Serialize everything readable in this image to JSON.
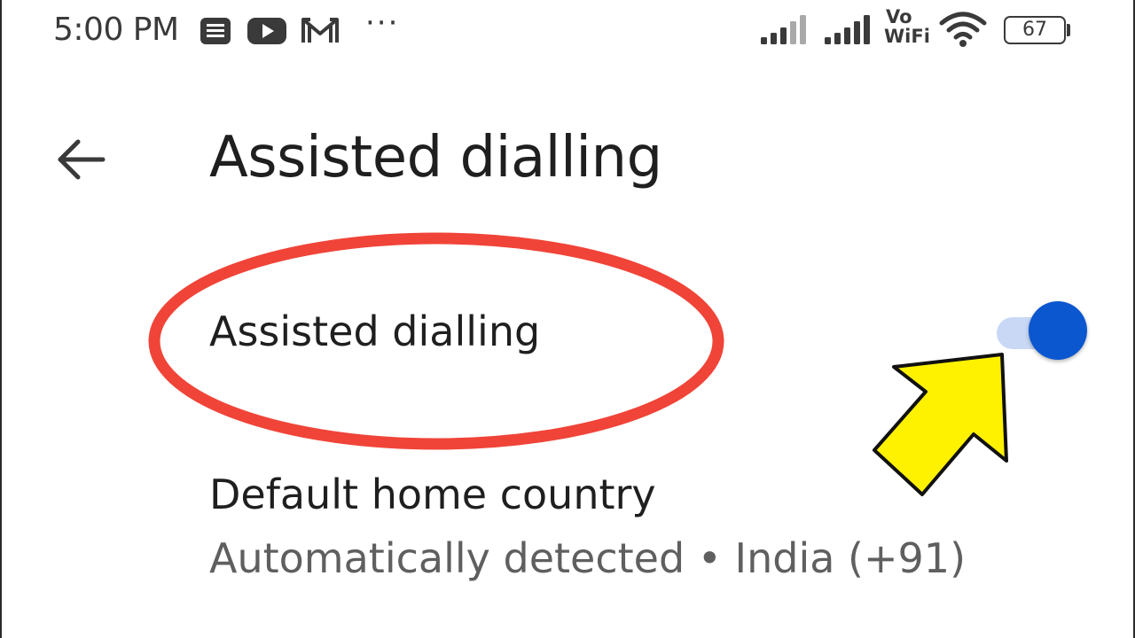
{
  "status_bar": {
    "time": "5:00 PM",
    "notification_icons": [
      "news-icon",
      "youtube-icon",
      "gmail-icon"
    ],
    "more_notifications": "···",
    "signal_icons": [
      "signal-sim1-icon",
      "signal-sim2-icon"
    ],
    "vowifi_top": "Vo",
    "vowifi_bottom": "WiFi",
    "wifi_icon": "wifi-icon",
    "battery_level": "67"
  },
  "app_bar": {
    "back_icon": "arrow-back-icon",
    "title": "Assisted dialling"
  },
  "settings": {
    "assisted_dialling": {
      "title": "Assisted dialling",
      "enabled": true
    },
    "default_home_country": {
      "title": "Default home country",
      "summary": "Automatically detected • India (+91)"
    }
  },
  "annotations": {
    "highlight_color": "#f04438",
    "arrow_color": "#fff200",
    "toggle_active_color": "#0b57d0",
    "toggle_track_color": "#c8d8f5"
  }
}
